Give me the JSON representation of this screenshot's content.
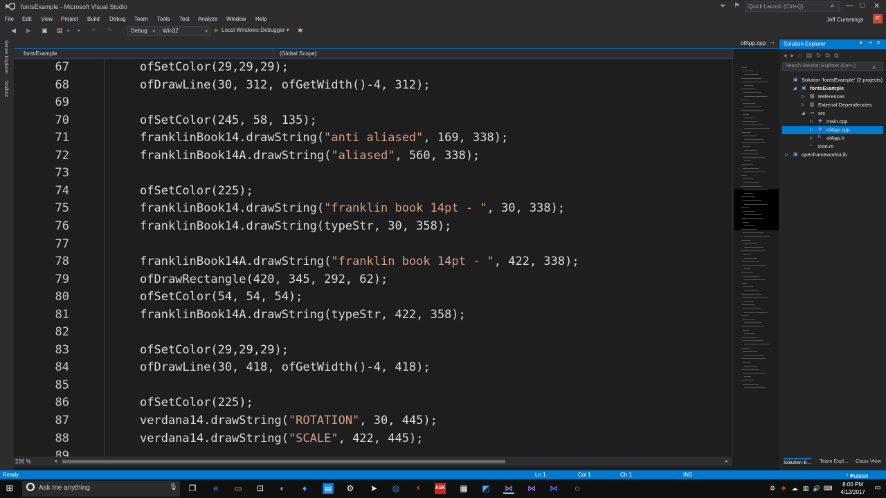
{
  "window": {
    "title": "fontsExample - Microsoft Visual Studio",
    "quick_launch_placeholder": "Quick Launch (Ctrl+Q)",
    "user": "Jeff Cummings",
    "user_initials": "JC"
  },
  "menu": [
    "File",
    "Edit",
    "View",
    "Project",
    "Build",
    "Debug",
    "Team",
    "Tools",
    "Test",
    "Analyze",
    "Window",
    "Help"
  ],
  "toolbar": {
    "config": "Debug",
    "platform": "Win32",
    "debugger": "Local Windows Debugger"
  },
  "left_strip": [
    "Server Explorer",
    "Toolbox"
  ],
  "editor": {
    "tab": "ofApp.cpp",
    "project_dropdown": "fontsExample",
    "scope_dropdown": "(Global Scope)",
    "zoom": "226 %",
    "lines": [
      {
        "n": "67",
        "parts": [
          [
            "ofSetColor(29,29,29);",
            "c"
          ]
        ]
      },
      {
        "n": "68",
        "parts": [
          [
            "ofDrawLine(30, 312, ofGetWidth()-4, 312);",
            "c"
          ]
        ]
      },
      {
        "n": "69",
        "parts": []
      },
      {
        "n": "70",
        "parts": [
          [
            "ofSetColor(245, 58, 135);",
            "c"
          ]
        ]
      },
      {
        "n": "71",
        "parts": [
          [
            "franklinBook14.drawString(",
            "c"
          ],
          [
            "\"anti aliased\"",
            "s"
          ],
          [
            ", 169, 338);",
            "c"
          ]
        ]
      },
      {
        "n": "72",
        "parts": [
          [
            "franklinBook14A.drawString(",
            "c"
          ],
          [
            "\"aliased\"",
            "s"
          ],
          [
            ", 560, 338);",
            "c"
          ]
        ]
      },
      {
        "n": "73",
        "parts": []
      },
      {
        "n": "74",
        "parts": [
          [
            "ofSetColor(225);",
            "c"
          ]
        ]
      },
      {
        "n": "75",
        "parts": [
          [
            "franklinBook14.drawString(",
            "c"
          ],
          [
            "\"franklin book 14pt - \"",
            "s"
          ],
          [
            ", 30, 338);",
            "c"
          ]
        ]
      },
      {
        "n": "76",
        "parts": [
          [
            "franklinBook14.drawString(typeStr, 30, 358);",
            "c"
          ]
        ]
      },
      {
        "n": "77",
        "parts": []
      },
      {
        "n": "78",
        "parts": [
          [
            "franklinBook14A.drawString(",
            "c"
          ],
          [
            "\"franklin book 14pt - \"",
            "s"
          ],
          [
            ", 422, 338);",
            "c"
          ]
        ]
      },
      {
        "n": "79",
        "parts": [
          [
            "ofDrawRectangle(420, 345, 292, 62);",
            "c"
          ]
        ]
      },
      {
        "n": "80",
        "parts": [
          [
            "ofSetColor(54, 54, 54);",
            "c"
          ]
        ]
      },
      {
        "n": "81",
        "parts": [
          [
            "franklinBook14A.drawString(typeStr, 422, 358);",
            "c"
          ]
        ]
      },
      {
        "n": "82",
        "parts": []
      },
      {
        "n": "83",
        "parts": [
          [
            "ofSetColor(29,29,29);",
            "c"
          ]
        ]
      },
      {
        "n": "84",
        "parts": [
          [
            "ofDrawLine(30, 418, ofGetWidth()-4, 418);",
            "c"
          ]
        ]
      },
      {
        "n": "85",
        "parts": []
      },
      {
        "n": "86",
        "parts": [
          [
            "ofSetColor(225);",
            "c"
          ]
        ]
      },
      {
        "n": "87",
        "parts": [
          [
            "verdana14.drawString(",
            "c"
          ],
          [
            "\"ROTATION\"",
            "s"
          ],
          [
            ", 30, 445);",
            "c"
          ]
        ]
      },
      {
        "n": "88",
        "parts": [
          [
            "verdana14.drawString(",
            "c"
          ],
          [
            "\"SCALE\"",
            "s"
          ],
          [
            ", 422, 445);",
            "c"
          ]
        ]
      },
      {
        "n": "89",
        "parts": []
      }
    ]
  },
  "solution_explorer": {
    "title": "Solution Explorer",
    "search_placeholder": "Search Solution Explorer (Ctrl+;)",
    "tree": [
      {
        "label": "Solution 'fontsExample' (2 projects)",
        "depth": 0,
        "icon": "solution-icon",
        "exp": ""
      },
      {
        "label": "fontsExample",
        "depth": 1,
        "icon": "project-icon",
        "exp": "◢",
        "bold": true
      },
      {
        "label": "References",
        "depth": 2,
        "icon": "references-icon",
        "exp": "▷"
      },
      {
        "label": "External Dependencies",
        "depth": 2,
        "icon": "dependencies-icon",
        "exp": "▷"
      },
      {
        "label": "src",
        "depth": 2,
        "icon": "folder-icon",
        "exp": "◢"
      },
      {
        "label": "main.cpp",
        "depth": 3,
        "icon": "cpp-file-icon",
        "exp": "▷"
      },
      {
        "label": "ofApp.cpp",
        "depth": 3,
        "icon": "cpp-file-icon",
        "exp": "▷",
        "selected": true
      },
      {
        "label": "ofApp.h",
        "depth": 3,
        "icon": "header-file-icon",
        "exp": "▷"
      },
      {
        "label": "icon.rc",
        "depth": 2,
        "icon": "resource-file-icon",
        "exp": ""
      },
      {
        "label": "openframeworksLib",
        "depth": 0,
        "icon": "project-icon",
        "exp": "▷"
      }
    ],
    "bottom_tabs": [
      "Solution E...",
      "Team Expl...",
      "Class View"
    ]
  },
  "status": {
    "state": "Ready",
    "ln": "Ln 1",
    "col": "Col 1",
    "ch": "Ch 1",
    "mode": "INS",
    "publish": "Publish"
  },
  "taskbar": {
    "search_placeholder": "Ask me anything",
    "time": "8:00 PM",
    "date": "4/12/2017"
  },
  "colors": {
    "accent": "#007acc",
    "string": "#d69d85",
    "code": "#dcdcdc",
    "bg": "#1e1e1e"
  }
}
